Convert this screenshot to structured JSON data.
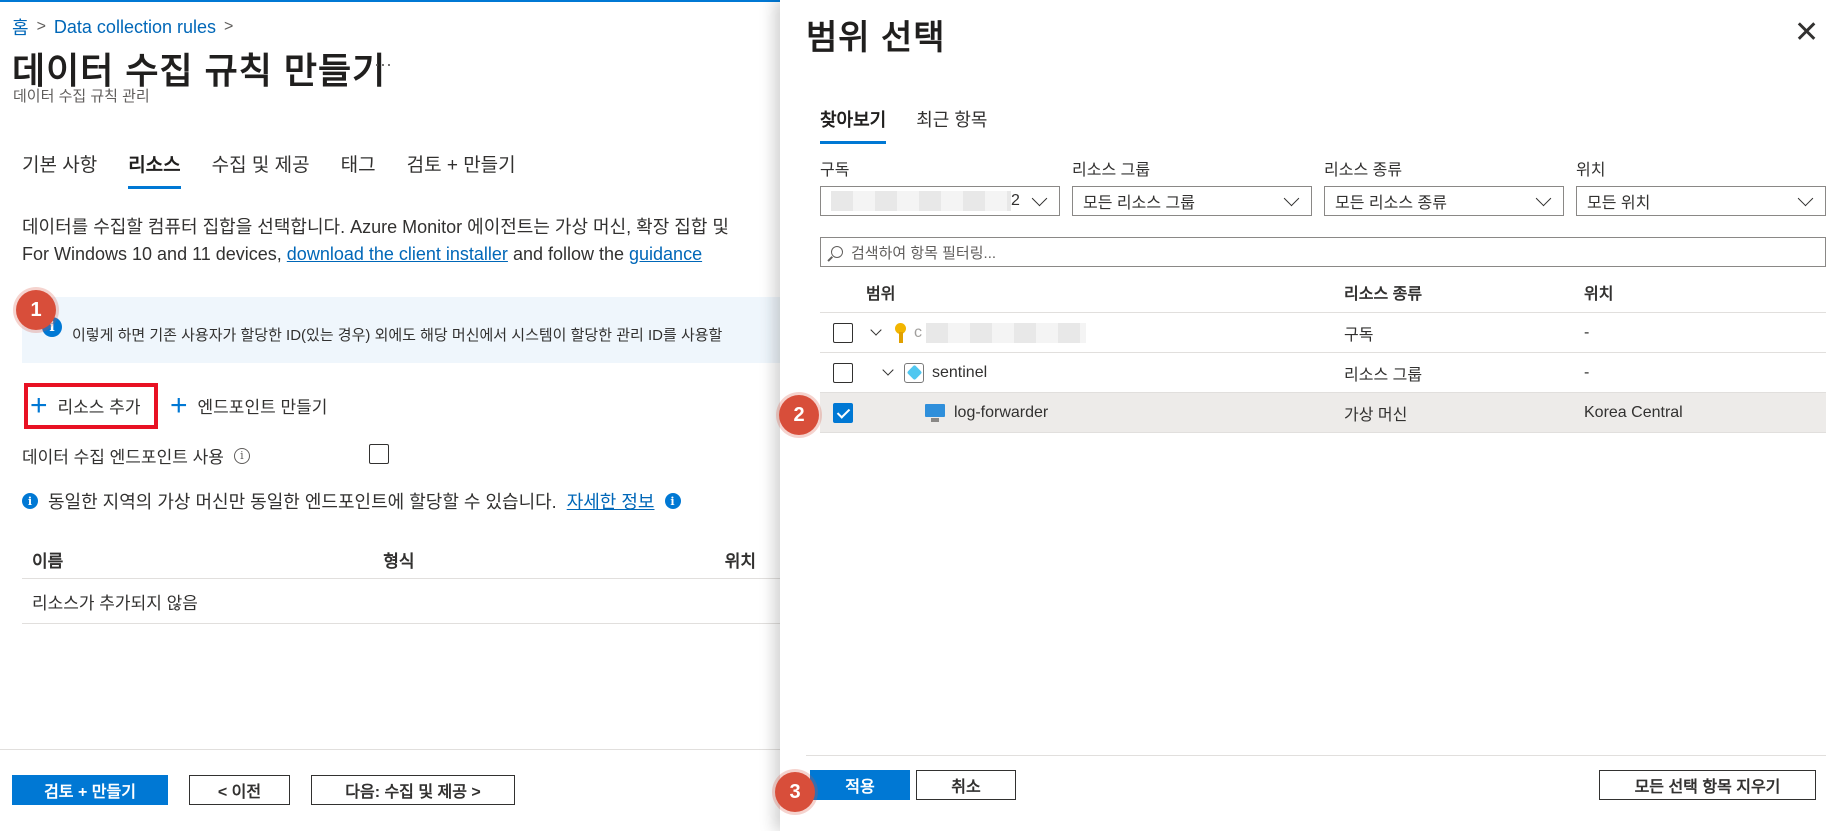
{
  "breadcrumb": {
    "home": "홈",
    "item": "Data collection rules"
  },
  "page": {
    "title": "데이터 수집 규칙 만들기",
    "more": "···",
    "subtitle": "데이터 수집 규칙 관리"
  },
  "tabs": [
    "기본 사항",
    "리소스",
    "수집 및 제공",
    "태그",
    "검토 + 만들기"
  ],
  "active_tab": "리소스",
  "description": {
    "line1": "데이터를 수집할 컴퓨터 집합을 선택합니다. Azure Monitor 에이전트는 가상 머신, 확장 집합 및",
    "line2_prefix": "For Windows 10 and 11 devices, ",
    "link1": "download the client installer",
    "line2_mid": " and follow the ",
    "link2": "guidance"
  },
  "info_banner": "이렇게 하면 기존 사용자가 할당한 ID(있는 경우) 외에도 해당 머신에서 시스템이 할당한 관리 ID를 사용할",
  "commands": {
    "add_resource": "리소스 추가",
    "create_endpoint": "엔드포인트 만들기"
  },
  "endpoint_option": {
    "label": "데이터 수집 엔드포인트 사용",
    "checked": false
  },
  "region_note": {
    "text": "동일한 지역의 가상 머신만 동일한 엔드포인트에 할당할 수 있습니다.",
    "link": "자세한 정보"
  },
  "resource_table": {
    "columns": [
      "이름",
      "형식",
      "위치"
    ],
    "empty_text": "리소스가 추가되지 않음"
  },
  "footer": {
    "review_create": "검토 + 만들기",
    "prev": "< 이전",
    "next": "다음: 수집 및 제공 >"
  },
  "step_badges": [
    "1",
    "2",
    "3"
  ],
  "panel": {
    "title": "범위 선택",
    "close": "✕",
    "tabs": [
      "찾아보기",
      "최근 항목"
    ],
    "filters": [
      {
        "label": "구독",
        "value": "2"
      },
      {
        "label": "리소스 그룹",
        "value": "모든 리소스 그룹"
      },
      {
        "label": "리소스 종류",
        "value": "모든 리소스 종류"
      },
      {
        "label": "위치",
        "value": "모든 위치"
      }
    ],
    "search_placeholder": "검색하여 항목 필터링...",
    "columns": [
      "범위",
      "리소스 종류",
      "위치"
    ],
    "rows": [
      {
        "name": "c",
        "type": "구독",
        "location": "-",
        "checked": false
      },
      {
        "name": "sentinel",
        "type": "리소스 그룹",
        "location": "-",
        "checked": false
      },
      {
        "name": "log-forwarder",
        "type": "가상 머신",
        "location": "Korea Central",
        "checked": true
      }
    ],
    "apply": "적용",
    "cancel": "취소",
    "clear_all": "모든 선택 항목 지우기"
  },
  "colors": {
    "accent": "#0078d4",
    "highlight_box": "#e81123",
    "badge": "#d84e3a"
  }
}
